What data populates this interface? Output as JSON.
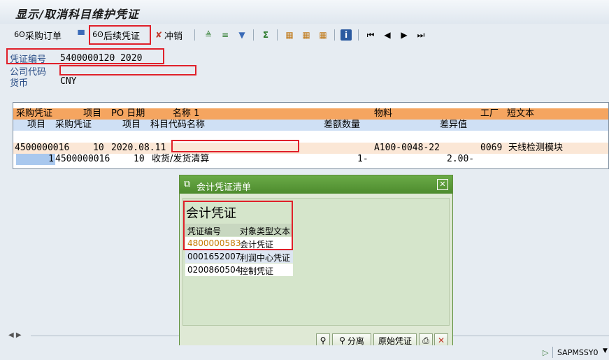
{
  "window": {
    "title": "显示/取消科目维护凭证"
  },
  "toolbar": {
    "po_label": "采购订单",
    "followup_label": "后续凭证",
    "reverse_label": "冲销"
  },
  "header": {
    "doc_no_label": "凭证编号",
    "doc_no_value": "5400000120 2020",
    "company_label": "公司代码",
    "currency_label": "货币",
    "currency_value": "CNY"
  },
  "table": {
    "header1": [
      "采购凭证",
      "项目",
      "PO 日期",
      "名称 1",
      "物料",
      "工厂",
      "短文本"
    ],
    "header2": [
      "项目",
      "采购凭证",
      "项目",
      "科目代码名称",
      "差额数量",
      "差异值"
    ],
    "row1": {
      "po": "4500000016",
      "item": "10",
      "date": "2020.08.11",
      "material": "A100-0048-22",
      "plant": "0069",
      "text": "天线检测模块"
    },
    "row2": {
      "item": "1",
      "po": "4500000016",
      "po_item": "10",
      "account_name": "收货/发货清算",
      "qty": "1-",
      "value": "2.00-"
    }
  },
  "popup": {
    "title": "会计凭证清单",
    "heading": "会计凭证",
    "columns": [
      "凭证编号",
      "对象类型文本"
    ],
    "rows": [
      {
        "doc": "4800000583",
        "type": "会计凭证"
      },
      {
        "doc": "0001652007",
        "type": "利润中心凭证"
      },
      {
        "doc": "0200860504",
        "type": "控制凭证"
      }
    ],
    "buttons": {
      "split": "分离",
      "original": "原始凭证"
    }
  },
  "status": {
    "program": "SAPMSSY0"
  },
  "colors": {
    "highlight": "#e0202a",
    "table_header": "#f5a560",
    "table_subheader": "#cfe0f5",
    "row_odd": "#fbe7d6",
    "popup_title": "#5c9c3a"
  }
}
